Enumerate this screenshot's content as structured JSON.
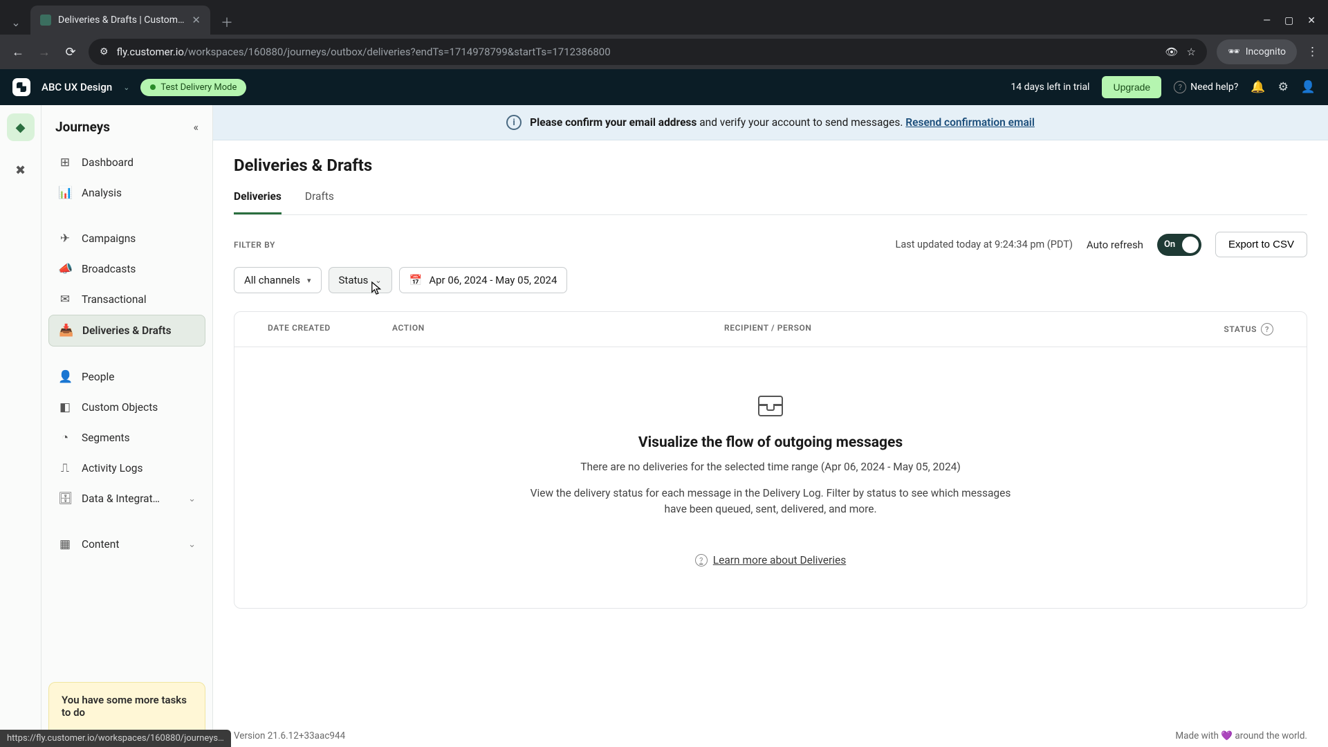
{
  "browser": {
    "tab_title": "Deliveries & Drafts | Customer...",
    "url_host": "fly.customer.io",
    "url_path": "/workspaces/160880/journeys/outbox/deliveries?endTs=1714978799&startTs=1712386800",
    "incognito": "Incognito",
    "status_url": "https://fly.customer.io/workspaces/160880/journeys…"
  },
  "header": {
    "workspace": "ABC UX Design",
    "mode": "Test Delivery Mode",
    "trial": "14 days left in trial",
    "upgrade": "Upgrade",
    "help": "Need help?"
  },
  "sidebar": {
    "title": "Journeys",
    "items": [
      {
        "label": "Dashboard"
      },
      {
        "label": "Analysis"
      },
      {
        "label": "Campaigns"
      },
      {
        "label": "Broadcasts"
      },
      {
        "label": "Transactional"
      },
      {
        "label": "Deliveries & Drafts"
      },
      {
        "label": "People"
      },
      {
        "label": "Custom Objects"
      },
      {
        "label": "Segments"
      },
      {
        "label": "Activity Logs"
      },
      {
        "label": "Data & Integrat…"
      },
      {
        "label": "Content"
      }
    ],
    "toast": "You have some more tasks to do"
  },
  "banner": {
    "bold": "Please confirm your email address",
    "rest": " and verify your account to send messages. ",
    "link": "Resend confirmation email"
  },
  "page": {
    "title": "Deliveries & Drafts",
    "tabs": [
      {
        "label": "Deliveries",
        "active": true
      },
      {
        "label": "Drafts",
        "active": false
      }
    ],
    "filter_label": "FILTER BY",
    "updated": "Last updated today at 9:24:34 pm (PDT)",
    "auto_refresh": "Auto refresh",
    "toggle_on": "On",
    "export": "Export to CSV",
    "filters": {
      "channels": "All channels",
      "status": "Status",
      "date_range": "Apr 06, 2024 - May 05, 2024"
    },
    "columns": {
      "date": "DATE CREATED",
      "action": "ACTION",
      "recipient": "RECIPIENT / PERSON",
      "status": "STATUS"
    },
    "empty": {
      "title": "Visualize the flow of outgoing messages",
      "sub": "There are no deliveries for the selected time range (Apr 06, 2024 - May 05, 2024)",
      "desc": "View the delivery status for each message in the Delivery Log. Filter by status to see which messages have been queued, sent, delivered, and more.",
      "learn": "Learn more about Deliveries"
    }
  },
  "footer": {
    "version": "Version 21.6.12+33aac944",
    "made": "Made with 💜 around the world."
  }
}
